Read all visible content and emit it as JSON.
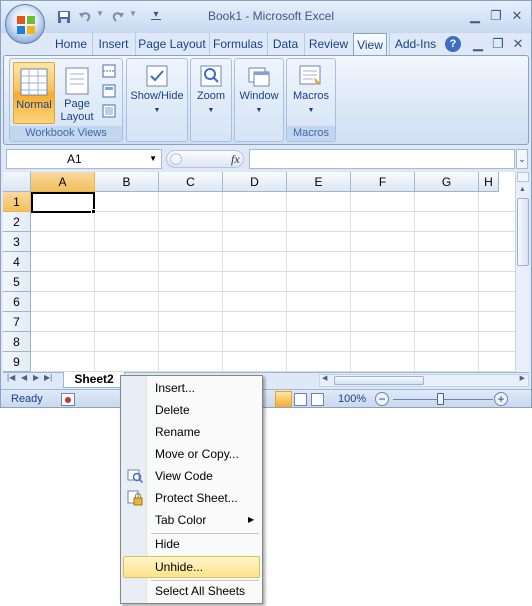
{
  "window": {
    "title": "Book1 - Microsoft Excel"
  },
  "ribbon_tabs": [
    "Home",
    "Insert",
    "Page Layout",
    "Formulas",
    "Data",
    "Review",
    "View",
    "Add-Ins"
  ],
  "active_tab": "View",
  "ribbon": {
    "normal_label": "Normal",
    "page_layout_label": "Page Layout",
    "group_workbook_views": "Workbook Views",
    "show_hide_label": "Show/Hide",
    "zoom_label": "Zoom",
    "window_label": "Window",
    "macros_label": "Macros",
    "group_macros": "Macros"
  },
  "formula_bar": {
    "name_box": "A1",
    "fx": "fx",
    "formula": ""
  },
  "grid": {
    "columns": [
      "A",
      "B",
      "C",
      "D",
      "E",
      "F",
      "G",
      "H"
    ],
    "rows": [
      "1",
      "2",
      "3",
      "4",
      "5",
      "6",
      "7",
      "8",
      "9"
    ],
    "selected_cell": "A1"
  },
  "sheet_tabs": {
    "active": "Sheet2"
  },
  "status": {
    "ready": "Ready",
    "zoom": "100%"
  },
  "context_menu": {
    "items": [
      {
        "label": "Insert...",
        "icon": ""
      },
      {
        "label": "Delete",
        "icon": ""
      },
      {
        "label": "Rename",
        "icon": ""
      },
      {
        "label": "Move or Copy...",
        "icon": ""
      },
      {
        "label": "View Code",
        "icon": "view-code-icon"
      },
      {
        "label": "Protect Sheet...",
        "icon": "protect-sheet-icon"
      },
      {
        "label": "Tab Color",
        "icon": "",
        "submenu": true
      },
      {
        "label": "Hide",
        "icon": ""
      },
      {
        "label": "Unhide...",
        "icon": "",
        "highlighted": true
      },
      {
        "label": "Select All Sheets",
        "icon": ""
      }
    ]
  },
  "colors": {
    "accent": "#f7aa2e",
    "ribbon_bg": "#dfe8f6",
    "header_blue": "#15428b",
    "gridline": "#dadcdd"
  }
}
